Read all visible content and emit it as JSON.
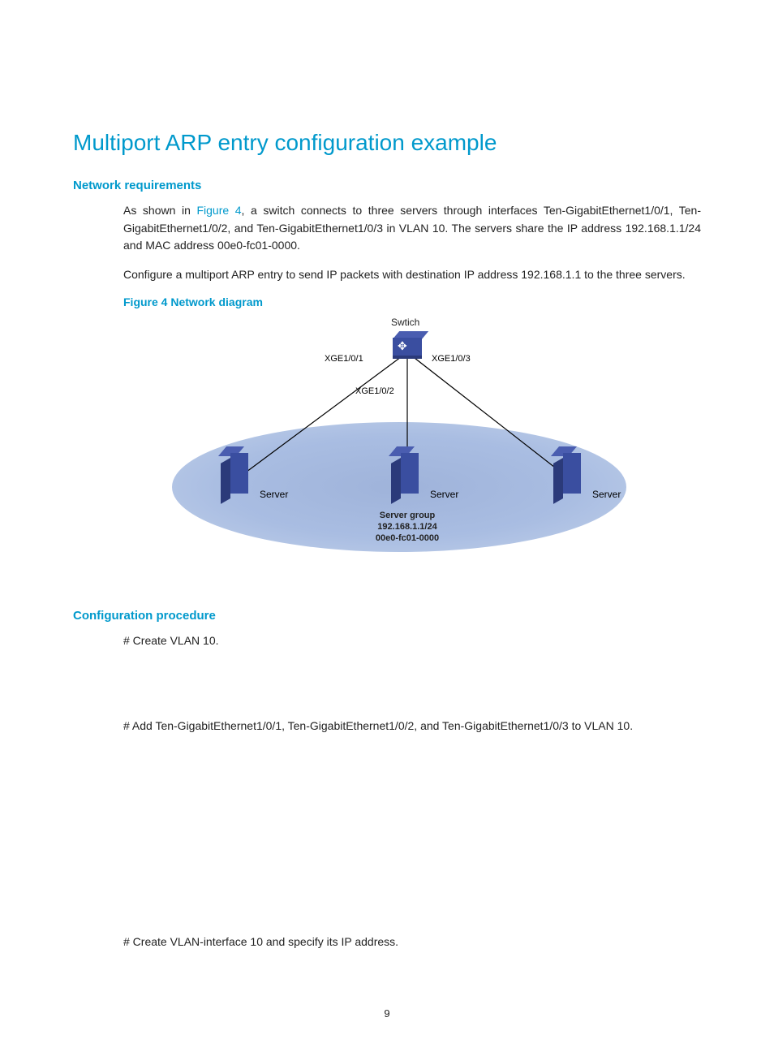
{
  "title": "Multiport ARP entry configuration example",
  "section_network_requirements": "Network requirements",
  "paragraph1_pre": "As shown in ",
  "figure_link": "Figure 4",
  "paragraph1_post": ", a switch connects to three servers through interfaces Ten-GigabitEthernet1/0/1, Ten-GigabitEthernet1/0/2, and Ten-GigabitEthernet1/0/3 in VLAN 10. The servers share the IP address 192.168.1.1/24 and MAC address 00e0-fc01-0000.",
  "paragraph2": "Configure a multiport ARP entry to send IP packets with destination IP address 192.168.1.1 to the three servers.",
  "figure_caption": "Figure 4 Network diagram",
  "diagram": {
    "switch_label": "Swtich",
    "port1": "XGE1/0/1",
    "port2": "XGE1/0/2",
    "port3": "XGE1/0/3",
    "server_label": "Server",
    "group_name": "Server group",
    "group_ip": "192.168.1.1/24",
    "group_mac": "00e0-fc01-0000"
  },
  "section_config_procedure": "Configuration procedure",
  "step1": "# Create VLAN 10.",
  "step2": "# Add Ten-GigabitEthernet1/0/1, Ten-GigabitEthernet1/0/2, and Ten-GigabitEthernet1/0/3 to VLAN 10.",
  "step3": "# Create VLAN-interface 10 and specify its IP address.",
  "page_number": "9"
}
